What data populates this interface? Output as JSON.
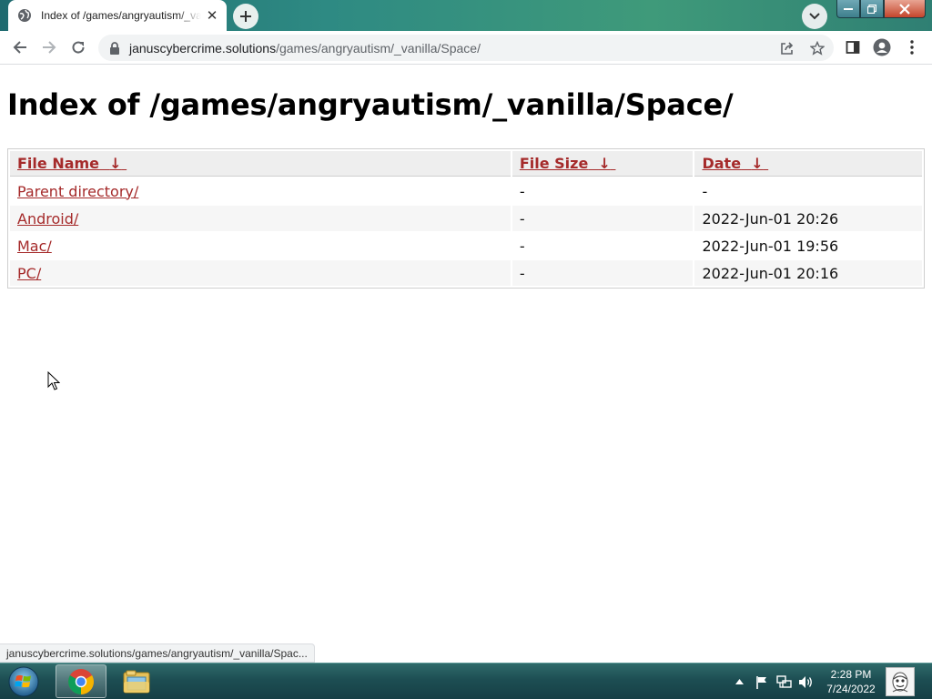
{
  "browser": {
    "tab": {
      "title": "Index of /games/angryautism/_vanilla/Space/",
      "favicon": "globe-icon"
    },
    "address": {
      "host": "januscybercrime.solutions",
      "path": "/games/angryautism/_vanilla/Space/"
    },
    "status_url": "januscybercrime.solutions/games/angryautism/_vanilla/Spac..."
  },
  "page": {
    "heading": "Index of /games/angryautism/_vanilla/Space/",
    "columns": {
      "name": "File Name",
      "size": "File Size",
      "date": "Date",
      "sort_arrow": "↓"
    },
    "rows": [
      {
        "name": "Parent directory/",
        "size": "-",
        "date": "-"
      },
      {
        "name": "Android/",
        "size": "-",
        "date": "2022-Jun-01 20:26"
      },
      {
        "name": "Mac/",
        "size": "-",
        "date": "2022-Jun-01 19:56"
      },
      {
        "name": "PC/",
        "size": "-",
        "date": "2022-Jun-01 20:16"
      }
    ],
    "link_color": "#a52a2a"
  },
  "taskbar": {
    "apps": [
      "chrome-icon",
      "file-explorer-icon"
    ],
    "time": "2:28 PM",
    "date": "7/24/2022"
  }
}
